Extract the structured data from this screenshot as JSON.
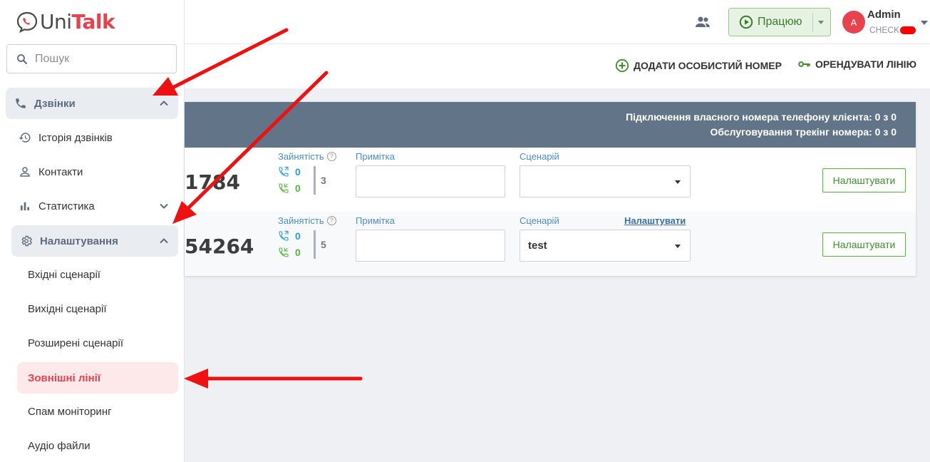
{
  "brand": {
    "name_part1": "Uni",
    "name_part2": "Talk",
    "accent": "#e8424f"
  },
  "search": {
    "placeholder": "Пошук"
  },
  "sidebar": {
    "calls_group": {
      "label": "Дзвінки"
    },
    "calls_items": [
      {
        "label": "Історія дзвінків",
        "icon": "history-icon"
      },
      {
        "label": "Контакти",
        "icon": "person-icon"
      },
      {
        "label": "Статистика",
        "icon": "bar-chart-icon"
      }
    ],
    "settings_group": {
      "label": "Налаштування"
    },
    "settings_items": [
      {
        "label": "Вхідні сценарії"
      },
      {
        "label": "Вихідні сценарії"
      },
      {
        "label": "Розширені сценарії"
      },
      {
        "label": "Зовнішні лінії",
        "active": true
      },
      {
        "label": "Спам моніторинг"
      },
      {
        "label": "Аудіо файли"
      }
    ]
  },
  "topbar": {
    "status_label": "Працюю",
    "user": {
      "initial": "A",
      "name": "Admin",
      "company": "CHECK"
    }
  },
  "actions": {
    "add_personal": "ДОДАТИ ОСОБИСТИЙ НОМЕР",
    "rent_line": "ОРЕНДУВАТИ ЛІНІЮ"
  },
  "card": {
    "header_line1": "Підключення власного номера телефону клієнта: 0 з 0",
    "header_line2": "Обслуговування трекінг номера: 0 з 0",
    "rows": [
      {
        "phone": "1784",
        "busy_label": "Зайнятість",
        "incoming": "0",
        "outgoing": "0",
        "total": "3",
        "note_label": "Примітка",
        "note_value": "",
        "scenario_label": "Сценарій",
        "scenario_value": "",
        "button": "Налаштувати"
      },
      {
        "phone": "54264",
        "busy_label": "Зайнятість",
        "incoming": "0",
        "outgoing": "0",
        "total": "5",
        "note_label": "Примітка",
        "note_value": "",
        "scenario_label": "Сценарій",
        "scenario_link": "Налаштувати",
        "scenario_value": "test",
        "button": "Налаштувати"
      }
    ]
  }
}
